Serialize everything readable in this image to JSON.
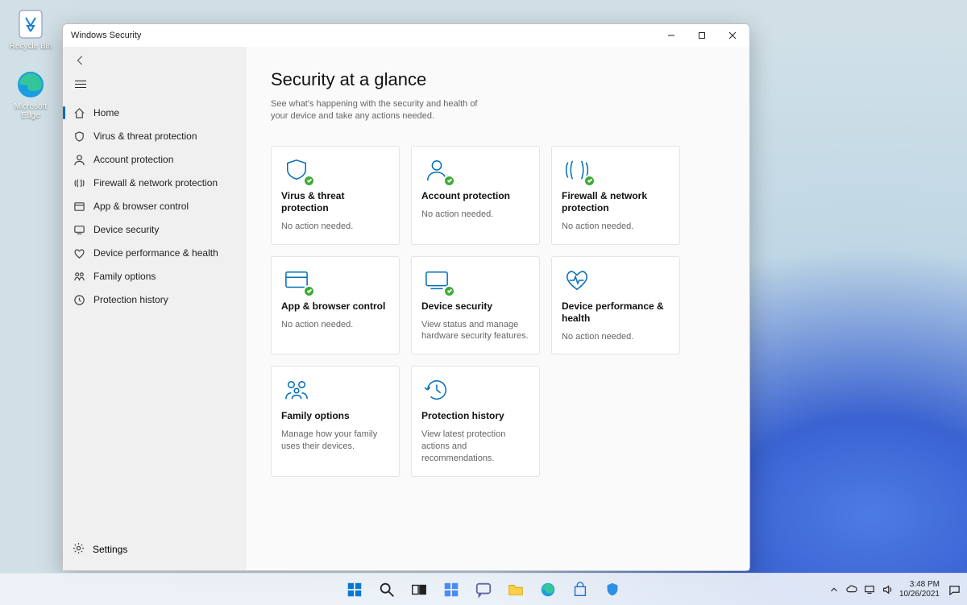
{
  "desktop": {
    "icons": [
      {
        "label": "Recycle Bin"
      },
      {
        "label": "Microsoft Edge"
      }
    ]
  },
  "window": {
    "title": "Windows Security"
  },
  "sidebar": {
    "items": [
      {
        "label": "Home"
      },
      {
        "label": "Virus & threat protection"
      },
      {
        "label": "Account protection"
      },
      {
        "label": "Firewall & network protection"
      },
      {
        "label": "App & browser control"
      },
      {
        "label": "Device security"
      },
      {
        "label": "Device performance & health"
      },
      {
        "label": "Family options"
      },
      {
        "label": "Protection history"
      }
    ],
    "settings_label": "Settings"
  },
  "main": {
    "heading": "Security at a glance",
    "subtitle": "See what's happening with the security and health of your device and take any actions needed."
  },
  "tiles": [
    {
      "title": "Virus & threat protection",
      "desc": "No action needed.",
      "check": true
    },
    {
      "title": "Account protection",
      "desc": "No action needed.",
      "check": true
    },
    {
      "title": "Firewall & network protection",
      "desc": "No action needed.",
      "check": true
    },
    {
      "title": "App & browser control",
      "desc": "No action needed.",
      "check": true
    },
    {
      "title": "Device security",
      "desc": "View status and manage hardware security features.",
      "check": true
    },
    {
      "title": "Device performance & health",
      "desc": "No action needed.",
      "check": false
    },
    {
      "title": "Family options",
      "desc": "Manage how your family uses their devices.",
      "check": false
    },
    {
      "title": "Protection history",
      "desc": "View latest protection actions and recommendations.",
      "check": false
    }
  ],
  "taskbar": {
    "time": "3:48 PM",
    "date": "10/26/2021"
  }
}
